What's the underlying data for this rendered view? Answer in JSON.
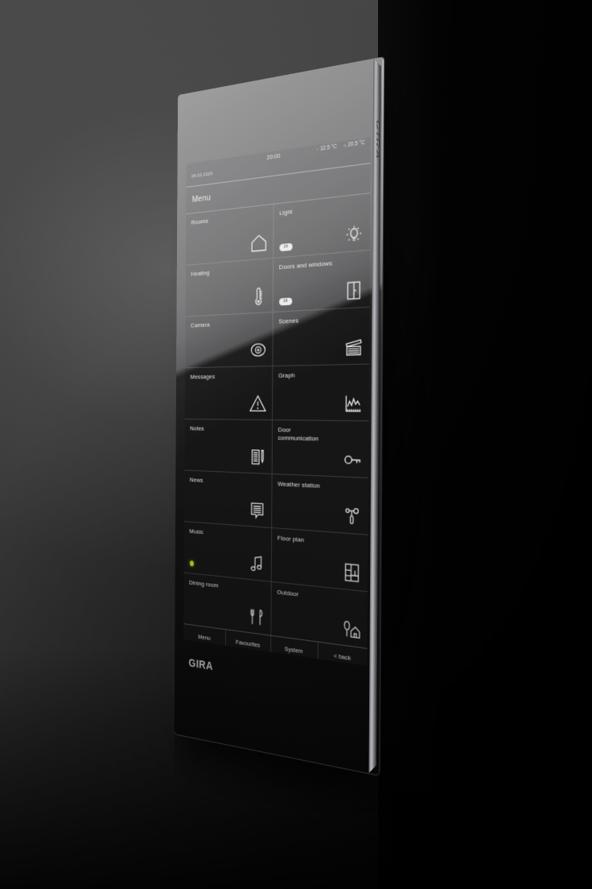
{
  "device": {
    "brand": "GIRA",
    "side_brand": "GIRA"
  },
  "statusbar": {
    "date": "08.03.2020",
    "time": "20:00",
    "temps": [
      {
        "label": "↑",
        "value": "12.5 °C"
      },
      {
        "label": "⌂",
        "value": "20.5 °C"
      }
    ]
  },
  "header": {
    "title": "Menu"
  },
  "tiles": [
    {
      "label": "Rooms",
      "icon": "house-icon",
      "badge": null,
      "dot": false
    },
    {
      "label": "Light",
      "icon": "lightbulb-icon",
      "badge": "14",
      "dot": false
    },
    {
      "label": "Heating",
      "icon": "thermometer-icon",
      "badge": null,
      "dot": false
    },
    {
      "label": "Doors and windows",
      "icon": "door-window-icon",
      "badge": "14",
      "dot": false
    },
    {
      "label": "Camera",
      "icon": "camera-eye-icon",
      "badge": null,
      "dot": false
    },
    {
      "label": "Scenes",
      "icon": "clapperboard-icon",
      "badge": null,
      "dot": false
    },
    {
      "label": "Messages",
      "icon": "warning-triangle-icon",
      "badge": null,
      "dot": false
    },
    {
      "label": "Graph",
      "icon": "line-chart-icon",
      "badge": null,
      "dot": false
    },
    {
      "label": "Notes",
      "icon": "notepad-pen-icon",
      "badge": null,
      "dot": false
    },
    {
      "label": "Door communication",
      "icon": "key-icon",
      "badge": null,
      "dot": false
    },
    {
      "label": "News",
      "icon": "newspaper-icon",
      "badge": null,
      "dot": false
    },
    {
      "label": "Weather station",
      "icon": "anemometer-icon",
      "badge": null,
      "dot": false
    },
    {
      "label": "Music",
      "icon": "music-note-icon",
      "badge": null,
      "dot": true
    },
    {
      "label": "Floor plan",
      "icon": "floorplan-icon",
      "badge": null,
      "dot": false
    },
    {
      "label": "Dining room",
      "icon": "cutlery-icon",
      "badge": null,
      "dot": false
    },
    {
      "label": "Outdoor",
      "icon": "tree-house-icon",
      "badge": null,
      "dot": false
    }
  ],
  "navbar": [
    {
      "label": "Menu"
    },
    {
      "label": "Favourites"
    },
    {
      "label": "System"
    },
    {
      "label": "< back"
    }
  ],
  "colors": {
    "status_dot": "#cdd91a",
    "badge_bg": "#e9e9e9",
    "screen_bg": "#0d0d0e",
    "tile_bg": "#161617",
    "wall": "#3b3b3b"
  }
}
